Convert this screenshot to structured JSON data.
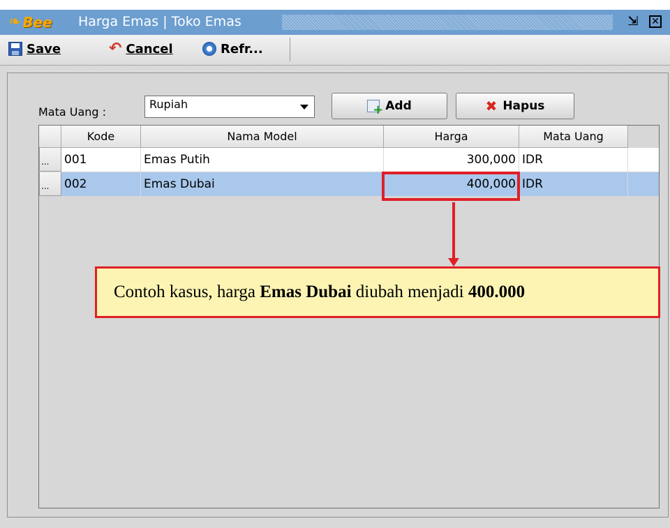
{
  "window": {
    "brand": "Bee",
    "title": "Harga Emas | Toko Emas"
  },
  "toolbar": {
    "save_label": "Save",
    "cancel_label": "Cancel",
    "refresh_label": "Refr..."
  },
  "filter": {
    "label": "Mata Uang :",
    "selected": "Rupiah"
  },
  "buttons": {
    "add": "Add",
    "hapus": "Hapus"
  },
  "table": {
    "columns": [
      "Kode",
      "Nama Model",
      "Harga",
      "Mata Uang"
    ],
    "rows": [
      {
        "handle": "...",
        "kode": "001",
        "nama": "Emas Putih",
        "harga": "300,000",
        "mata": "IDR"
      },
      {
        "handle": "...",
        "kode": "002",
        "nama": "Emas Dubai",
        "harga": "400,000",
        "mata": "IDR"
      }
    ]
  },
  "annotation": {
    "prefix": "Contoh kasus, harga ",
    "bold1": "Emas Dubai",
    "middle": " diubah menjadi ",
    "bold2": "400.000"
  },
  "colors": {
    "titlebar": "#6c9ed0",
    "selected_row": "#a9c8ec",
    "annotation_border": "#e01f26",
    "annotation_fill": "#fdf4b3"
  }
}
